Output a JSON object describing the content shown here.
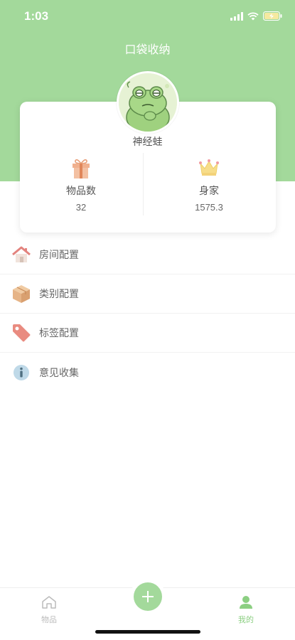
{
  "status_bar": {
    "time": "1:03"
  },
  "header": {
    "title": "口袋收纳"
  },
  "profile": {
    "name": "神经蛙"
  },
  "stats": [
    {
      "label": "物品数",
      "value": "32",
      "icon": "gift-icon"
    },
    {
      "label": "身家",
      "value": "1575.3",
      "icon": "crown-icon"
    }
  ],
  "menu": [
    {
      "label": "房间配置",
      "icon": "house-icon"
    },
    {
      "label": "类别配置",
      "icon": "box-icon"
    },
    {
      "label": "标签配置",
      "icon": "tag-icon"
    },
    {
      "label": "意见收集",
      "icon": "info-icon"
    }
  ],
  "tabbar": {
    "items_label": "物品",
    "mine_label": "我的",
    "active": "我的"
  },
  "colors": {
    "accent": "#a3d99b",
    "active_tab": "#8ccf82",
    "inactive_tab": "#bbbbbb"
  }
}
